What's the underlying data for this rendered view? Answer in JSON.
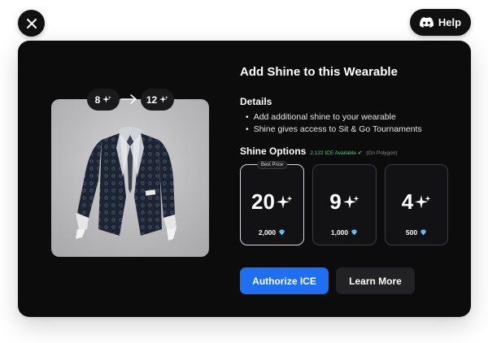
{
  "help_label": "Help",
  "modal": {
    "title": "Add Shine to this Wearable",
    "details_heading": "Details",
    "details": [
      "Add additional shine to your wearable",
      "Shine gives access to Sit & Go Tournaments"
    ],
    "options_heading": "Shine Options",
    "ice_available": "2,122 ICE Available ✔",
    "network_note": "(On Polygon)"
  },
  "preview": {
    "from_shine": "8",
    "to_shine": "12"
  },
  "options": [
    {
      "value": "20",
      "price": "2,000",
      "badge": "Best Price",
      "selected": true
    },
    {
      "value": "9",
      "price": "1,000",
      "selected": false
    },
    {
      "value": "4",
      "price": "500",
      "selected": false
    }
  ],
  "buttons": {
    "authorize": "Authorize ICE",
    "learn_more": "Learn More"
  },
  "colors": {
    "primary": "#1e6ff2",
    "available": "#3fd67a",
    "diamond": "#6cc6ff",
    "background": "#0c0c0d"
  },
  "icons": {
    "close": "close-icon",
    "help": "discord-icon",
    "shine": "sparkle-icon",
    "currency": "ice-diamond-icon",
    "arrow": "arrow-right-icon"
  }
}
